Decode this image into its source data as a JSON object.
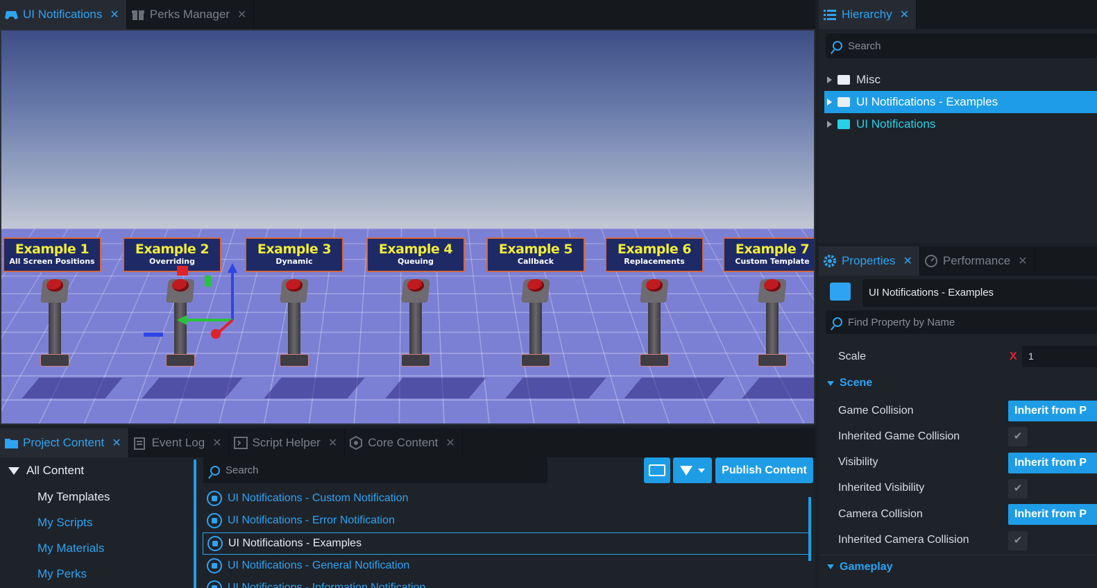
{
  "top_tabs": [
    {
      "label": "UI Notifications",
      "icon": "gamepad-icon"
    },
    {
      "label": "Perks Manager",
      "icon": "gift-icon"
    }
  ],
  "viewport": {
    "signs": [
      {
        "title": "Example 1",
        "subtitle": "All Screen Positions"
      },
      {
        "title": "Example 2",
        "subtitle": "Overriding"
      },
      {
        "title": "Example 3",
        "subtitle": "Dynamic"
      },
      {
        "title": "Example 4",
        "subtitle": "Queuing"
      },
      {
        "title": "Example 5",
        "subtitle": "Callback"
      },
      {
        "title": "Example 6",
        "subtitle": "Replacements"
      },
      {
        "title": "Example 7",
        "subtitle": "Custom Template"
      }
    ]
  },
  "hierarchy": {
    "tab": "Hierarchy",
    "search_placeholder": "Search",
    "items": [
      {
        "label": "Misc"
      },
      {
        "label": "UI Notifications - Examples"
      },
      {
        "label": "UI Notifications"
      }
    ]
  },
  "properties": {
    "tabs": [
      "Properties",
      "Performance"
    ],
    "object_name": "UI Notifications - Examples",
    "search_placeholder": "Find Property by Name",
    "scale_label": "Scale",
    "scale_value": "1",
    "scale_reset": "X",
    "scene_section": "Scene",
    "rows": [
      {
        "label": "Game Collision",
        "value": "Inherit from P"
      },
      {
        "label": "Inherited Game Collision",
        "check": "✔"
      },
      {
        "label": "Visibility",
        "value": "Inherit from P"
      },
      {
        "label": "Inherited Visibility",
        "check": "✔"
      },
      {
        "label": "Camera Collision",
        "value": "Inherit from P"
      },
      {
        "label": "Inherited Camera Collision",
        "check": "✔"
      }
    ],
    "gameplay_section": "Gameplay"
  },
  "bottom_tabs": [
    {
      "label": "Project Content",
      "icon": "folder-icon"
    },
    {
      "label": "Event Log",
      "icon": "clipboard-icon"
    },
    {
      "label": "Script Helper",
      "icon": "script-icon"
    },
    {
      "label": "Core Content",
      "icon": "hexagon-icon"
    }
  ],
  "content_tree": {
    "root": "All Content",
    "items": [
      "My Templates",
      "My Scripts",
      "My Materials",
      "My Perks"
    ]
  },
  "content_search_placeholder": "Search",
  "publish_label": "Publish Content",
  "assets": [
    "UI Notifications - Custom Notification",
    "UI Notifications - Error Notification",
    "UI Notifications - Examples",
    "UI Notifications - General Notification",
    "UI Notifications - Information Notification"
  ],
  "colors": {
    "accent": "#1e9de6",
    "panel": "#1e232a",
    "sign_text": "#f1ec3b"
  }
}
